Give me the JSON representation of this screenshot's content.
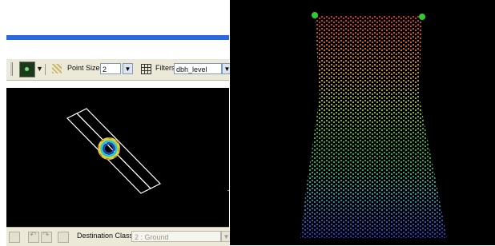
{
  "toolbar": {
    "point_size_label": "Point Size:",
    "point_size_value": "2",
    "filters_label": "Filters:",
    "filters_value": "dbh_level",
    "dropdown_arrow": "▼"
  },
  "status_bar": {
    "destination_class_label": "Destination Class:",
    "destination_class_value": "2 : Ground",
    "dropdown_arrow": "▼"
  },
  "icons": [
    "point-cloud-icon",
    "points-icon",
    "grid-icon",
    "undo-icon",
    "redo-icon"
  ],
  "colors": {
    "toolbar_bg": "#ece9d8",
    "viewport_bg": "#000000",
    "outline": "#ffffff",
    "marker": "#2ecc2e",
    "gradient_top": "#d13a2a",
    "gradient_mid": "#2fb43a",
    "gradient_bottom": "#2a3bd1"
  }
}
